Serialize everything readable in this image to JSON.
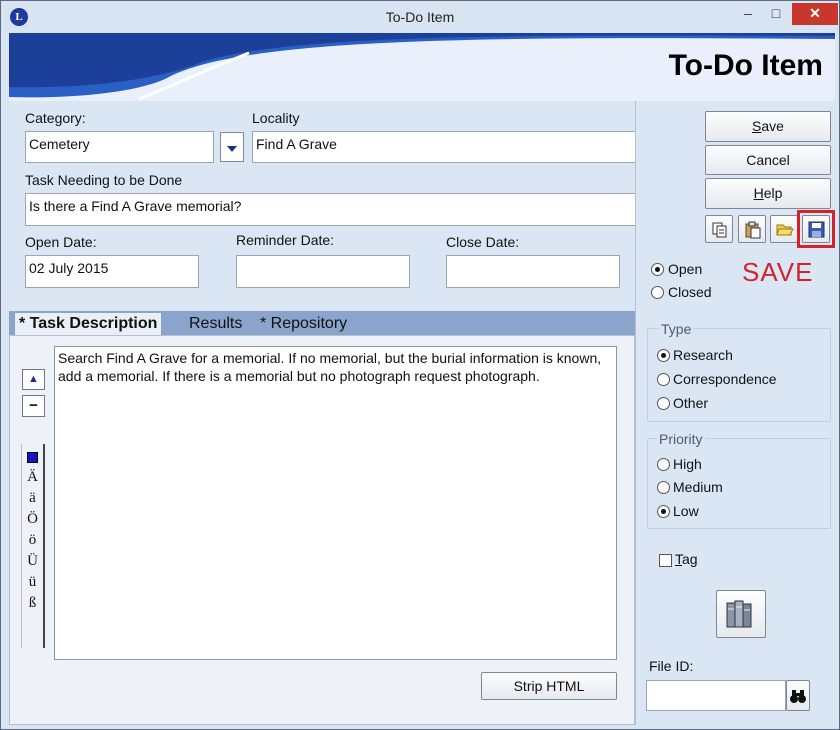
{
  "window": {
    "title": "To-Do Item",
    "logo_letter": "L",
    "min_glyph": "–",
    "max_glyph": "□",
    "close_glyph": "✕"
  },
  "banner": {
    "title": "To-Do Item"
  },
  "form": {
    "category_label": "Category:",
    "category_value": "Cemetery",
    "locality_label": "Locality",
    "locality_value": "Find A Grave",
    "task_label": "Task Needing to be Done",
    "task_value": "Is there a Find A Grave memorial?",
    "open_date_label": "Open Date:",
    "open_date_value": "02 July 2015",
    "reminder_date_label": "Reminder Date:",
    "reminder_date_value": "",
    "close_date_label": "Close Date:",
    "close_date_value": ""
  },
  "buttons": {
    "save_key": "S",
    "save_rest": "ave",
    "cancel": "Cancel",
    "help_key": "H",
    "help_rest": "elp",
    "strip_html": "Strip HTML"
  },
  "annotation": {
    "save_text": "SAVE",
    "color": "#d2222a"
  },
  "status": {
    "open_label": "Open",
    "closed_label": "Closed",
    "selected": "Open"
  },
  "type_group": {
    "title": "Type",
    "options": [
      "Research",
      "Correspondence",
      "Other"
    ],
    "selected": "Research"
  },
  "priority_group": {
    "title": "Priority",
    "options": [
      "High",
      "Medium",
      "Low"
    ],
    "selected": "Low"
  },
  "tag": {
    "key": "T",
    "rest": "ag",
    "checked": false
  },
  "tabs": [
    {
      "label": "* Task Description",
      "active": true
    },
    {
      "label": "Results",
      "active": false
    },
    {
      "label": "* Repository",
      "active": false
    }
  ],
  "description_text": "Search Find A Grave for a memorial.  If no memorial, but the burial information is known, add a memorial.  If there is a memorial but no photograph request photograph.",
  "special_chars": [
    "Ä",
    "ä",
    "Ö",
    "ö",
    "Ü",
    "ü",
    "ß"
  ],
  "side_tools": {
    "up_glyph": "▲",
    "minus_glyph": "−"
  },
  "file_id": {
    "label": "File ID:",
    "value": ""
  },
  "colors": {
    "accent_blue": "#1c2f86",
    "banner_wave": "#2a5fc4",
    "tab_bar": "#8aa4cc"
  }
}
